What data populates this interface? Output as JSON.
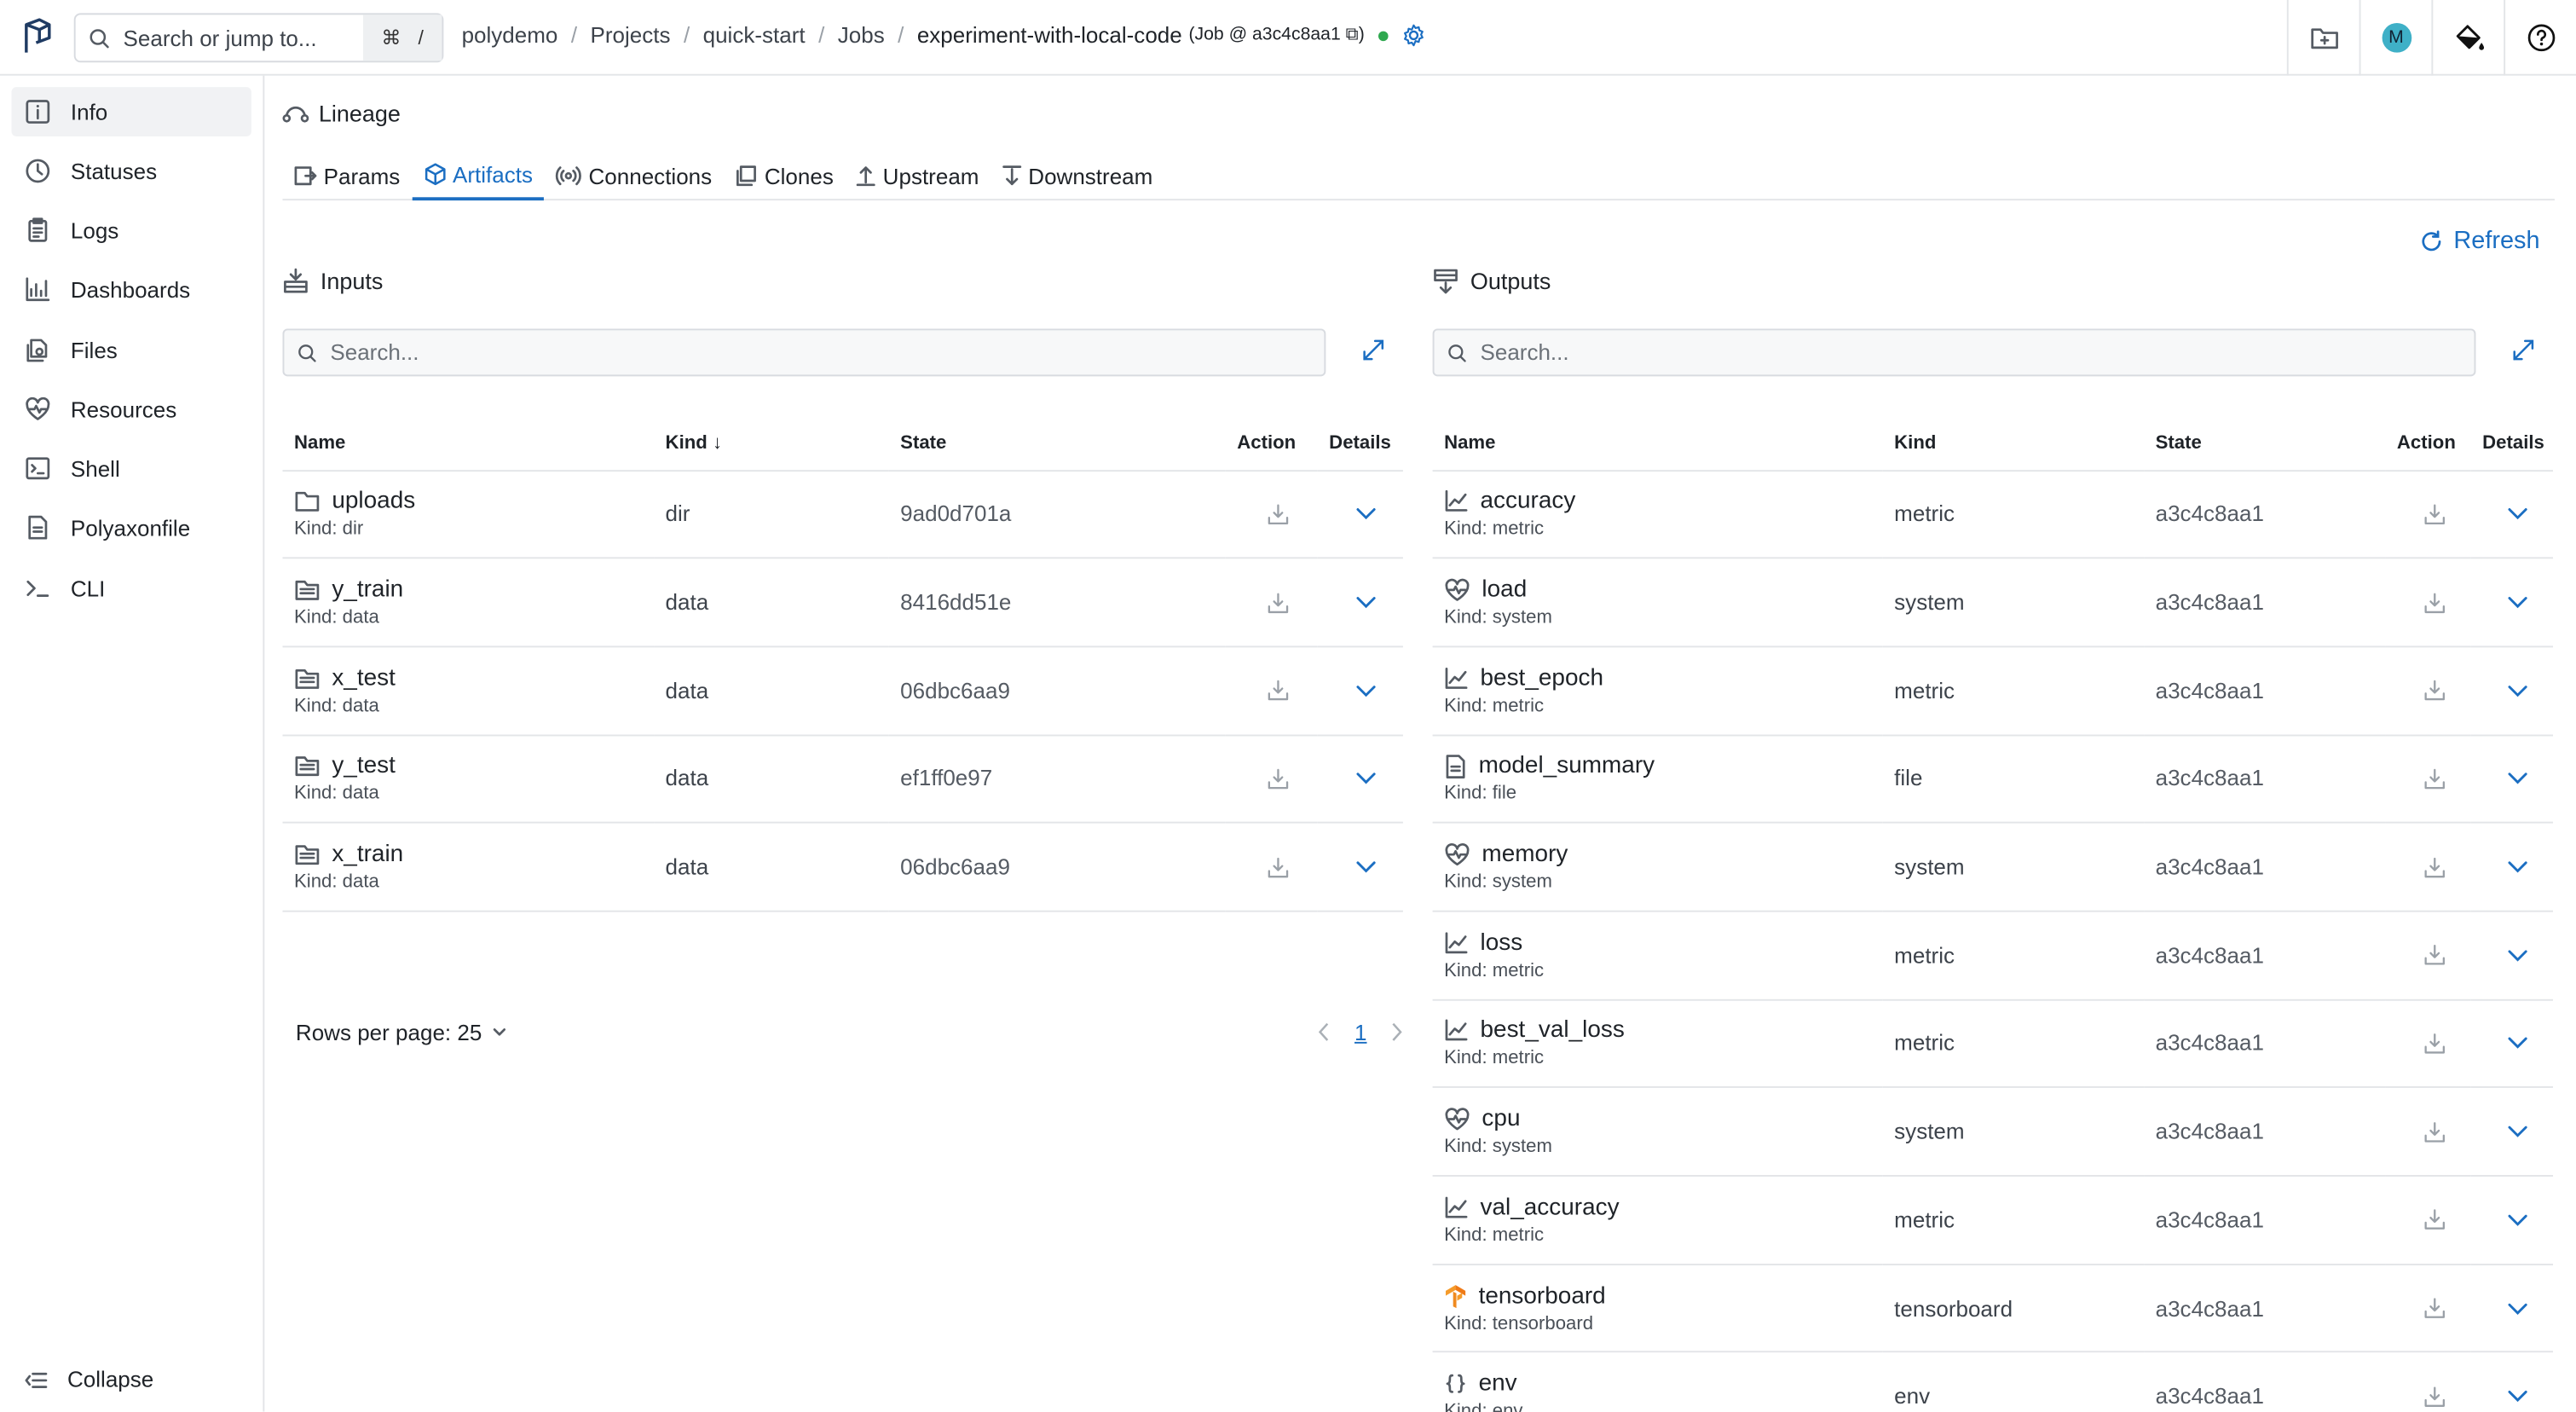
{
  "topbar": {
    "search_placeholder": "Search or jump to...",
    "shortcut_cmd": "⌘",
    "shortcut_key": "/",
    "breadcrumbs": [
      "polydemo",
      "Projects",
      "quick-start",
      "Jobs"
    ],
    "current": "experiment-with-local-code",
    "job_info": "(Job @ a3c4c8aa1 ⧉)",
    "avatar_initial": "M",
    "status_color": "#2fa84f"
  },
  "sidebar": {
    "items": [
      {
        "label": "Info",
        "icon": "info-icon"
      },
      {
        "label": "Statuses",
        "icon": "clock-icon"
      },
      {
        "label": "Logs",
        "icon": "clipboard-icon"
      },
      {
        "label": "Dashboards",
        "icon": "chart-icon"
      },
      {
        "label": "Files",
        "icon": "files-icon"
      },
      {
        "label": "Resources",
        "icon": "heartbeat-icon"
      },
      {
        "label": "Shell",
        "icon": "terminal-icon"
      },
      {
        "label": "Polyaxonfile",
        "icon": "file-icon"
      },
      {
        "label": "CLI",
        "icon": "prompt-icon"
      }
    ],
    "collapse_label": "Collapse"
  },
  "main": {
    "section_title": "Lineage",
    "tabs": [
      "Params",
      "Artifacts",
      "Connections",
      "Clones",
      "Upstream",
      "Downstream"
    ],
    "active_tab": "Artifacts",
    "refresh_label": "Refresh",
    "accent": "#1b6ec2"
  },
  "inputs": {
    "title": "Inputs",
    "search_placeholder": "Search...",
    "columns": [
      "Name",
      "Kind",
      "State",
      "Action",
      "Details"
    ],
    "kind_sort": "↓",
    "rows": [
      {
        "name": "uploads",
        "sub": "Kind: dir",
        "kind": "dir",
        "state": "9ad0d701a",
        "icon": "folder-icon"
      },
      {
        "name": "y_train",
        "sub": "Kind: data",
        "kind": "data",
        "state": "8416dd51e",
        "icon": "dataset-icon"
      },
      {
        "name": "x_test",
        "sub": "Kind: data",
        "kind": "data",
        "state": "06dbc6aa9",
        "icon": "dataset-icon"
      },
      {
        "name": "y_test",
        "sub": "Kind: data",
        "kind": "data",
        "state": "ef1ff0e97",
        "icon": "dataset-icon"
      },
      {
        "name": "x_train",
        "sub": "Kind: data",
        "kind": "data",
        "state": "06dbc6aa9",
        "icon": "dataset-icon"
      }
    ],
    "rows_per_page": "Rows per page: 25",
    "page": "1"
  },
  "outputs": {
    "title": "Outputs",
    "search_placeholder": "Search...",
    "columns": [
      "Name",
      "Kind",
      "State",
      "Action",
      "Details"
    ],
    "rows": [
      {
        "name": "accuracy",
        "sub": "Kind: metric",
        "kind": "metric",
        "state": "a3c4c8aa1",
        "icon": "metric-icon"
      },
      {
        "name": "load",
        "sub": "Kind: system",
        "kind": "system",
        "state": "a3c4c8aa1",
        "icon": "heartbeat-icon"
      },
      {
        "name": "best_epoch",
        "sub": "Kind: metric",
        "kind": "metric",
        "state": "a3c4c8aa1",
        "icon": "metric-icon"
      },
      {
        "name": "model_summary",
        "sub": "Kind: file",
        "kind": "file",
        "state": "a3c4c8aa1",
        "icon": "file-icon"
      },
      {
        "name": "memory",
        "sub": "Kind: system",
        "kind": "system",
        "state": "a3c4c8aa1",
        "icon": "heartbeat-icon"
      },
      {
        "name": "loss",
        "sub": "Kind: metric",
        "kind": "metric",
        "state": "a3c4c8aa1",
        "icon": "metric-icon"
      },
      {
        "name": "best_val_loss",
        "sub": "Kind: metric",
        "kind": "metric",
        "state": "a3c4c8aa1",
        "icon": "metric-icon"
      },
      {
        "name": "cpu",
        "sub": "Kind: system",
        "kind": "system",
        "state": "a3c4c8aa1",
        "icon": "heartbeat-icon"
      },
      {
        "name": "val_accuracy",
        "sub": "Kind: metric",
        "kind": "metric",
        "state": "a3c4c8aa1",
        "icon": "metric-icon"
      },
      {
        "name": "tensorboard",
        "sub": "Kind: tensorboard",
        "kind": "tensorboard",
        "state": "a3c4c8aa1",
        "icon": "tensorboard-icon"
      },
      {
        "name": "env",
        "sub": "Kind: env",
        "kind": "env",
        "state": "a3c4c8aa1",
        "icon": "braces-icon"
      }
    ]
  }
}
